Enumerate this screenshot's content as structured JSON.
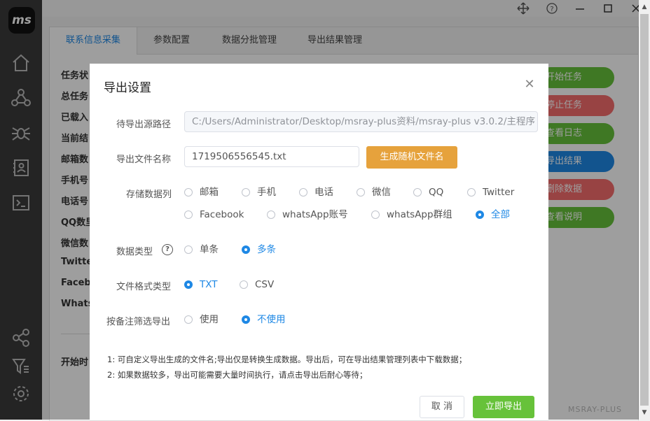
{
  "app": {
    "logo_text": "ms",
    "brand": "MSRAY-PLUS"
  },
  "tabs": [
    {
      "label": "联系信息采集"
    },
    {
      "label": "参数配置"
    },
    {
      "label": "数据分批管理"
    },
    {
      "label": "导出结果管理"
    }
  ],
  "panel": {
    "labels": [
      "任务状",
      "总任务",
      "已载入",
      "当前结",
      "邮箱数",
      "手机号",
      "电话号",
      "QQ数里",
      "微信数",
      "Twitte",
      "Facebo",
      "Whats",
      "开始时"
    ],
    "actions": [
      {
        "label": "开始任务",
        "color": "#67c23a"
      },
      {
        "label": "停止任务",
        "color": "#f56c6c"
      },
      {
        "label": "查看日志",
        "color": "#67c23a"
      },
      {
        "label": "导出结果",
        "color": "#1e88e5"
      },
      {
        "label": "删除数据",
        "color": "#f56c6c"
      },
      {
        "label": "查看说明",
        "color": "#67c23a"
      }
    ]
  },
  "modal": {
    "title": "导出设置",
    "source_path_label": "待导出源路径",
    "source_path_value": "C:/Users/Administrator/Desktop/msray-plus资料/msray-plus v3.0.2/主程序",
    "filename_label": "导出文件名称",
    "filename_value": "1719506556545.txt",
    "generate_label": "生成随机文件名",
    "columns_label": "存储数据列",
    "columns": [
      {
        "label": "邮箱",
        "checked": false
      },
      {
        "label": "手机",
        "checked": false
      },
      {
        "label": "电话",
        "checked": false
      },
      {
        "label": "微信",
        "checked": false
      },
      {
        "label": "QQ",
        "checked": false
      },
      {
        "label": "Twitter",
        "checked": false
      },
      {
        "label": "Facebook",
        "checked": false
      },
      {
        "label": "whatsApp账号",
        "checked": false
      },
      {
        "label": "whatsApp群组",
        "checked": false
      },
      {
        "label": "全部",
        "checked": true
      }
    ],
    "data_type_label": "数据类型",
    "data_types": [
      {
        "label": "单条",
        "checked": false
      },
      {
        "label": "多条",
        "checked": true
      }
    ],
    "format_label": "文件格式类型",
    "formats": [
      {
        "label": "TXT",
        "checked": true
      },
      {
        "label": "CSV",
        "checked": false
      }
    ],
    "remark_label": "按备注筛选导出",
    "remark_options": [
      {
        "label": "使用",
        "checked": false
      },
      {
        "label": "不使用",
        "checked": true
      }
    ],
    "notes": [
      "1: 可自定义导出生成的文件名;导出仅是转换生成数据。导出后，可在导出结果管理列表中下载数据；",
      "2: 如果数据较多，导出可能需要大量时间执行，请点击导出后耐心等待；"
    ],
    "cancel_label": "取 消",
    "export_label": "立即导出"
  }
}
